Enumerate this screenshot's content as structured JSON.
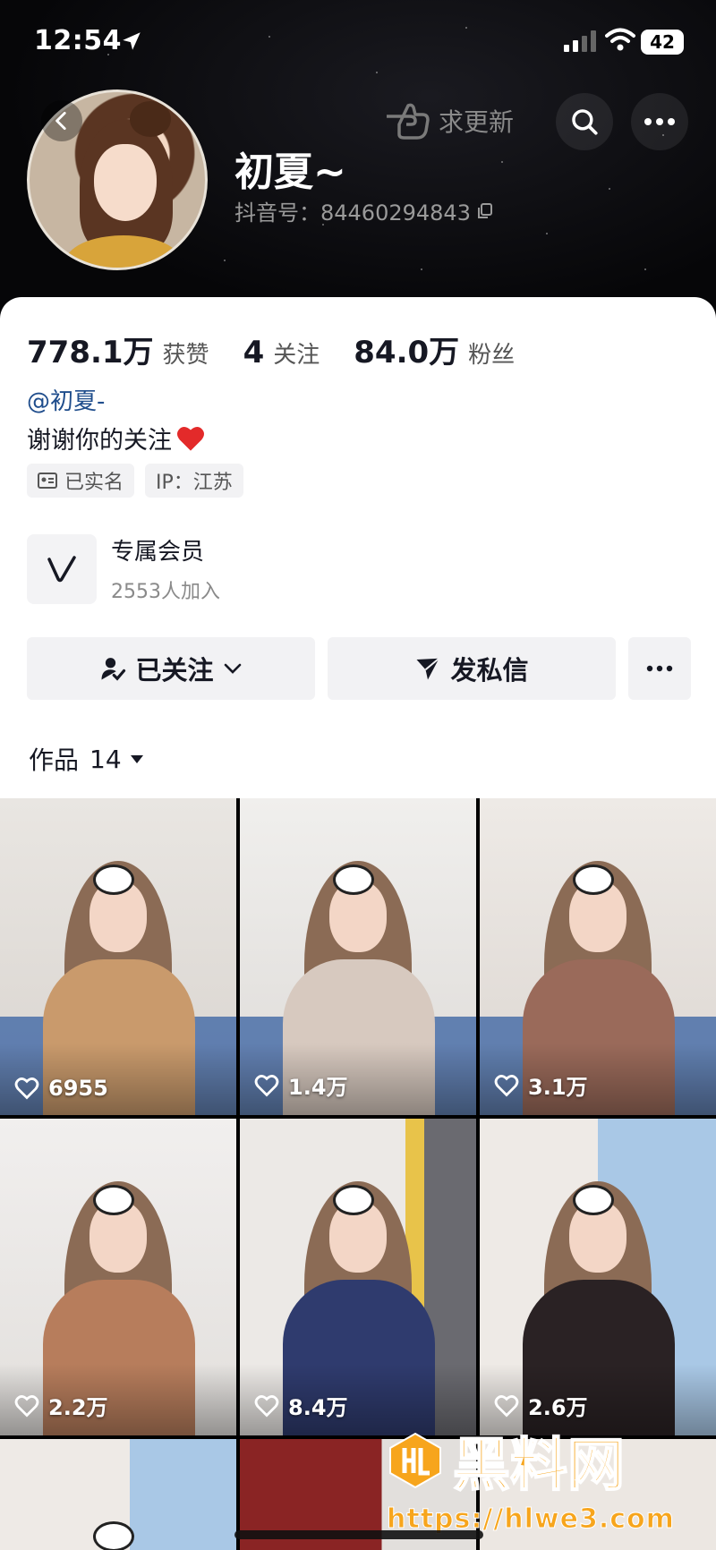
{
  "status_bar": {
    "time": "12:54",
    "battery": "42"
  },
  "header": {
    "request_update": "求更新",
    "nickname": "初夏~",
    "douyin_id": "抖音号：84460294843"
  },
  "profile": {
    "stats": [
      {
        "value": "778.1万",
        "label": "获赞"
      },
      {
        "value": "4",
        "label": "关注"
      },
      {
        "value": "84.0万",
        "label": "粉丝"
      }
    ],
    "handle": "@初夏-",
    "bio": "谢谢你的关注",
    "tags": {
      "verified": "已实名",
      "ip": "IP：江苏"
    },
    "membership": {
      "title": "专属会员",
      "subtitle": "2553人加入"
    },
    "buttons": {
      "follow": "已关注",
      "message": "发私信"
    },
    "works_tab": {
      "label": "作品",
      "count": "14"
    }
  },
  "videos": [
    {
      "likes": "6955"
    },
    {
      "likes": "1.4万"
    },
    {
      "likes": "3.1万"
    },
    {
      "likes": "2.2万"
    },
    {
      "likes": "8.4万"
    },
    {
      "likes": "2.6万"
    },
    {
      "likes": ""
    },
    {
      "likes": ""
    }
  ],
  "watermark": {
    "brand": "黑料网",
    "url": "https://hlwe3.com"
  },
  "colors": {
    "accent_link": "#1f4d8c",
    "watermark": "#f7a51c",
    "header_bg": "#060608",
    "heart": "#e32a2a"
  }
}
